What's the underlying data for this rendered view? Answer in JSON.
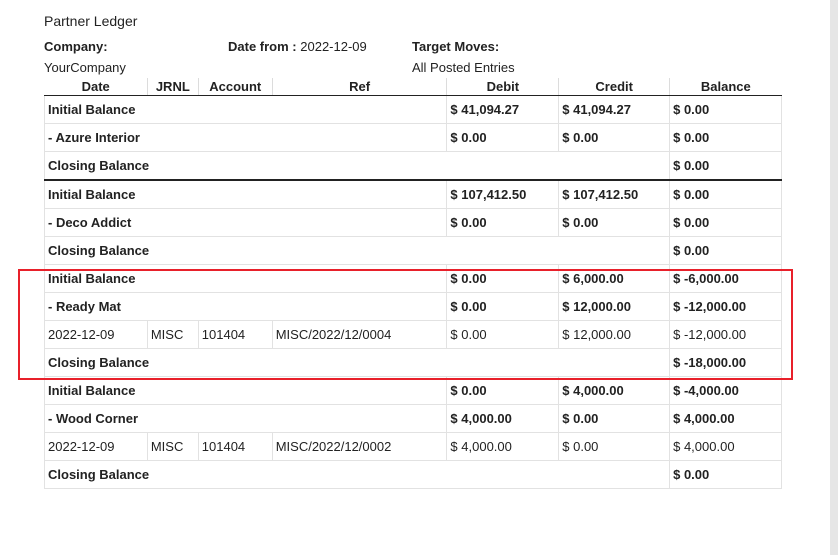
{
  "report": {
    "title": "Partner Ledger",
    "company_label": "Company:",
    "company_value": "YourCompany",
    "date_from_label": "Date from :",
    "date_from_value": "2022-12-09",
    "target_moves_label": "Target Moves:",
    "target_moves_value": "All Posted Entries"
  },
  "table": {
    "columns": [
      "Date",
      "JRNL",
      "Account",
      "Ref",
      "Debit",
      "Credit",
      "Balance"
    ],
    "groups": [
      {
        "initial": {
          "label": "Initial Balance",
          "debit": "$ 41,094.27",
          "credit": "$ 41,094.27",
          "balance": "$ 0.00"
        },
        "partner": {
          "label": "- Azure Interior",
          "debit": "$ 0.00",
          "credit": "$ 0.00",
          "balance": "$ 0.00"
        },
        "lines": [],
        "closing": {
          "label": "Closing Balance",
          "balance": "$ 0.00"
        }
      },
      {
        "initial": {
          "label": "Initial Balance",
          "debit": "$ 107,412.50",
          "credit": "$ 107,412.50",
          "balance": "$ 0.00"
        },
        "partner": {
          "label": "- Deco Addict",
          "debit": "$ 0.00",
          "credit": "$ 0.00",
          "balance": "$ 0.00"
        },
        "lines": [],
        "closing": {
          "label": "Closing Balance",
          "balance": "$ 0.00"
        }
      },
      {
        "initial": {
          "label": "Initial Balance",
          "debit": "$ 0.00",
          "credit": "$ 6,000.00",
          "balance": "$ -6,000.00"
        },
        "partner": {
          "label": "- Ready Mat",
          "debit": "$ 0.00",
          "credit": "$ 12,000.00",
          "balance": "$ -12,000.00"
        },
        "lines": [
          {
            "date": "2022-12-09",
            "jrnl": "MISC",
            "account": "101404",
            "ref": "MISC/2022/12/0004",
            "debit": "$ 0.00",
            "credit": "$ 12,000.00",
            "balance": "$ -12,000.00"
          }
        ],
        "closing": {
          "label": "Closing Balance",
          "balance": "$ -18,000.00"
        }
      },
      {
        "initial": {
          "label": "Initial Balance",
          "debit": "$ 0.00",
          "credit": "$ 4,000.00",
          "balance": "$ -4,000.00"
        },
        "partner": {
          "label": "- Wood Corner",
          "debit": "$ 4,000.00",
          "credit": "$ 0.00",
          "balance": "$ 4,000.00"
        },
        "lines": [
          {
            "date": "2022-12-09",
            "jrnl": "MISC",
            "account": "101404",
            "ref": "MISC/2022/12/0002",
            "debit": "$ 4,000.00",
            "credit": "$ 0.00",
            "balance": "$ 4,000.00"
          }
        ],
        "closing": {
          "label": "Closing Balance",
          "balance": "$ 0.00"
        }
      }
    ]
  },
  "colors": {
    "highlight": "#e8202a"
  }
}
